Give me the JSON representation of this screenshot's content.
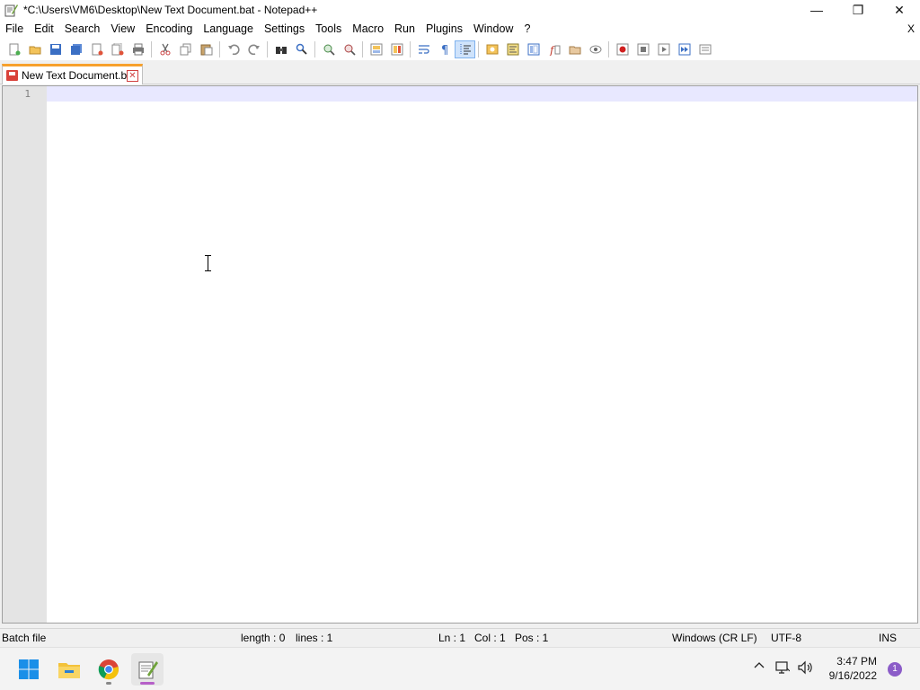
{
  "window": {
    "title": "*C:\\Users\\VM6\\Desktop\\New Text Document.bat - Notepad++",
    "app_icon": "notepadpp-icon",
    "controls": {
      "minimize": "—",
      "restore": "❐",
      "close": "✕"
    }
  },
  "menu": {
    "items": [
      "File",
      "Edit",
      "Search",
      "View",
      "Encoding",
      "Language",
      "Settings",
      "Tools",
      "Macro",
      "Run",
      "Plugins",
      "Window",
      "?"
    ],
    "close_label": "X"
  },
  "toolbar": {
    "groups": [
      [
        "new-file-icon",
        "open-file-icon",
        "save-icon",
        "save-all-icon",
        "close-icon",
        "close-all-icon",
        "print-icon"
      ],
      [
        "cut-icon",
        "copy-icon",
        "paste-icon"
      ],
      [
        "undo-icon",
        "redo-icon"
      ],
      [
        "find-icon",
        "replace-icon"
      ],
      [
        "zoom-in-icon",
        "zoom-out-icon"
      ],
      [
        "sync-vertical-icon",
        "sync-horizontal-icon"
      ],
      [
        "word-wrap-icon",
        "show-all-chars-icon",
        "indent-guide-icon"
      ],
      [
        "udl-icon",
        "doc-map-icon",
        "doc-list-icon",
        "function-list-icon",
        "folder-workspace-icon",
        "monitoring-icon"
      ],
      [
        "record-macro-icon",
        "stop-macro-icon",
        "play-macro-icon",
        "run-macro-multiple-icon",
        "save-macro-icon"
      ]
    ],
    "active": "indent-guide-icon"
  },
  "tabs": [
    {
      "label": "New Text Document.bat",
      "close": "✕",
      "icon": "unsaved-file-icon"
    }
  ],
  "editor": {
    "line_numbers": [
      "1"
    ],
    "content": ""
  },
  "status": {
    "language": "Batch file",
    "length": "length : 0",
    "lines": "lines : 1",
    "ln": "Ln : 1",
    "col": "Col : 1",
    "pos": "Pos : 1",
    "eol": "Windows (CR LF)",
    "encoding": "UTF-8",
    "mode": "INS"
  },
  "taskbar": {
    "apps": [
      "windows-start-icon",
      "file-explorer-icon",
      "chrome-icon",
      "notepadpp-icon"
    ],
    "active_app": "notepadpp-icon",
    "clock_time": "3:47 PM",
    "clock_date": "9/16/2022",
    "notification_count": "1"
  },
  "colors": {
    "tab_accent": "#f7a12c",
    "current_line": "#e8e8ff",
    "gutter": "#e4e4e4"
  }
}
